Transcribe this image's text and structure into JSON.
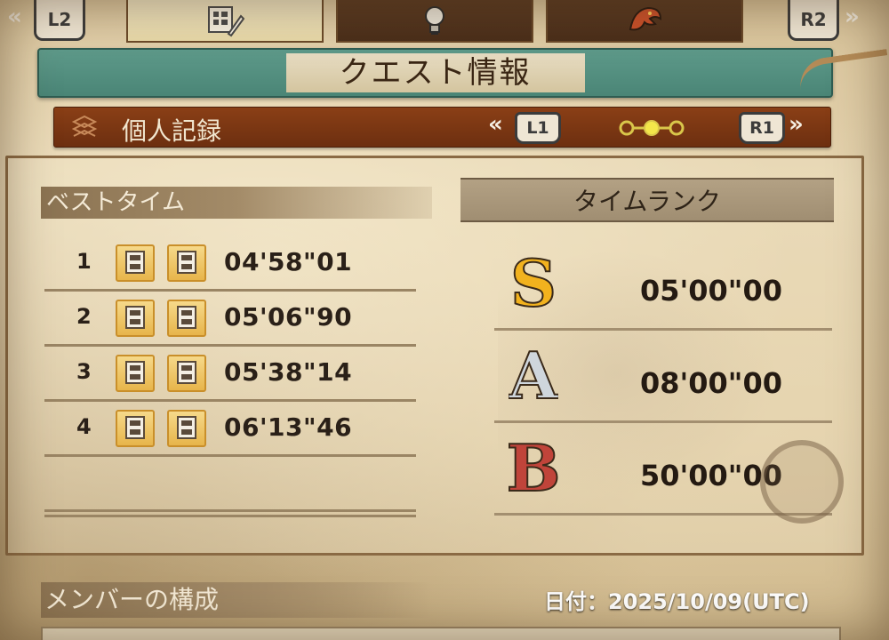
{
  "topbar": {
    "left_shoulder": "L2",
    "right_shoulder": "R2",
    "left_chevron": "«",
    "right_chevron": "»",
    "tabs": [
      {
        "icon": "quest-notes-icon",
        "active": true
      },
      {
        "icon": "lightbulb-icon",
        "active": false
      },
      {
        "icon": "monster-icon",
        "active": false
      }
    ]
  },
  "header": {
    "title": "クエスト情報"
  },
  "subheader": {
    "label": "個人記録",
    "left_button": "L1",
    "right_button": "R1",
    "left_chevron": "«",
    "right_chevron": "»",
    "page_indicator": {
      "count": 3,
      "current": 2
    }
  },
  "best_time": {
    "heading": "ベストタイム",
    "rows": [
      {
        "rank": "1",
        "time": "04'58\"01",
        "weapons": [
          "lance-icon",
          "greatsword-icon"
        ]
      },
      {
        "rank": "2",
        "time": "05'06\"90",
        "weapons": [
          "lance-icon",
          "greatsword-icon"
        ]
      },
      {
        "rank": "3",
        "time": "05'38\"14",
        "weapons": [
          "lance-icon",
          "greatsword-icon"
        ]
      },
      {
        "rank": "4",
        "time": "06'13\"46",
        "weapons": [
          "lance-icon",
          "greatsword-icon"
        ]
      }
    ]
  },
  "time_rank": {
    "heading": "タイムランク",
    "ranks": [
      {
        "letter": "S",
        "time": "05'00\"00",
        "color": "#f2b21e"
      },
      {
        "letter": "A",
        "time": "08'00\"00",
        "color": "#cfd6dc"
      },
      {
        "letter": "B",
        "time": "50'00\"00",
        "color": "#c0443a"
      }
    ]
  },
  "members": {
    "heading": "メンバーの構成",
    "date": "日付：2025/10/09(UTC)"
  },
  "colors": {
    "title_banner": "#4f8a7b",
    "sub_banner": "#7a3512",
    "weapon_icon": "#e7b54b"
  }
}
